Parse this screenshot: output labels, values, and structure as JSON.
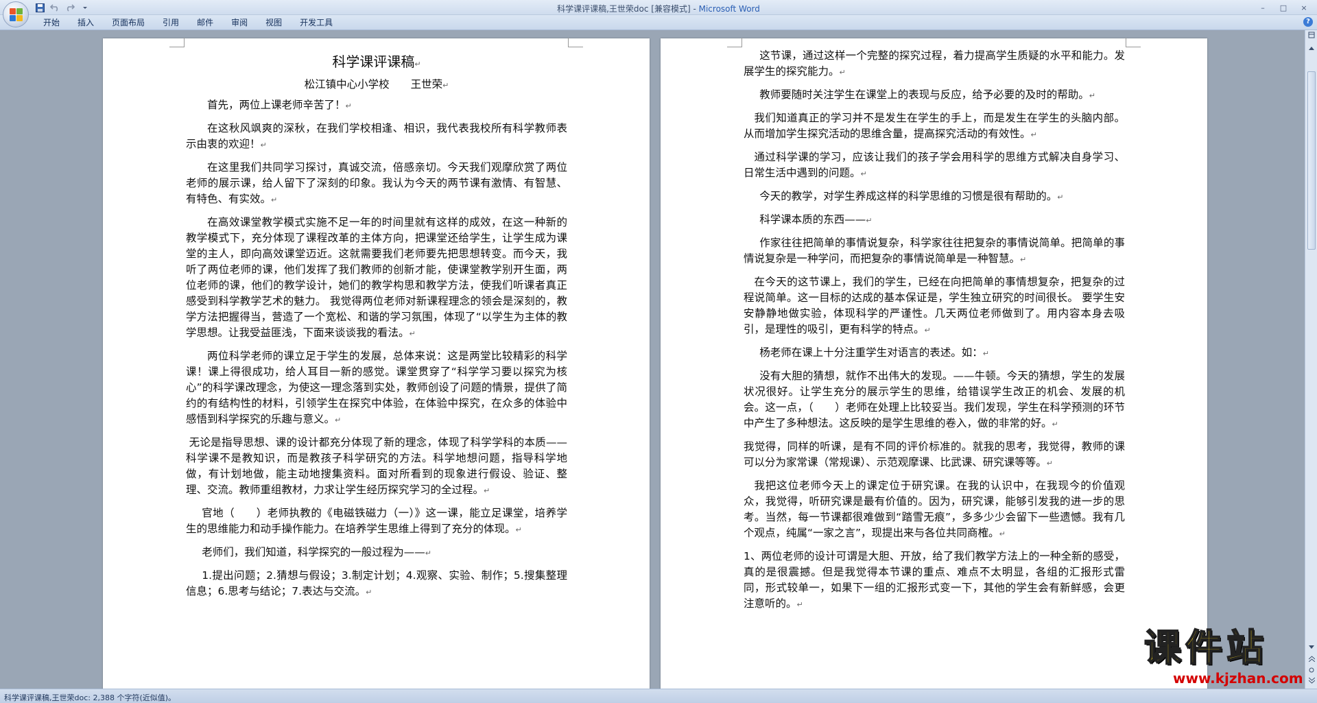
{
  "window": {
    "title": "科学课评课稿,王世荣doc [兼容模式] - ",
    "app": "Microsoft Word",
    "controls": [
      "–",
      "□",
      "×"
    ]
  },
  "quick_access": {
    "icons": [
      "save-icon",
      "undo-icon",
      "redo-icon",
      "customize-icon"
    ]
  },
  "ribbon": {
    "tabs": [
      "开始",
      "插入",
      "页面布局",
      "引用",
      "邮件",
      "审阅",
      "视图",
      "开发工具"
    ],
    "help": "?"
  },
  "doc": {
    "left": {
      "title": "科学课评课稿",
      "subtitle": "松江镇中心小学校　　王世荣",
      "paragraphs": [
        "首先，两位上课老师辛苦了！",
        "在这秋风飒爽的深秋，在我们学校相逢、相识，我代表我校所有科学教师表示由衷的欢迎！",
        "在这里我们共同学习探讨，真诚交流，倍感亲切。今天我们观摩欣赏了两位老师的展示课，给人留下了深刻的印象。我认为今天的两节课有激情、有智慧、有特色、有实效。",
        "在高效课堂教学模式实施不足一年的时间里就有这样的成效，在这一种新的教学模式下，充分体现了课程改革的主体方向，把课堂还给学生，让学生成为课堂的主人，即向高效课堂迈近。这就需要我们老师要先把思想转变。而今天，我听了两位老师的课，他们发挥了我们教师的创新才能，使课堂教学别开生面，两位老师的课，他们的教学设计，她们的教学构思和教学方法，使我们听课者真正感受到科学教学艺术的魅力。 我觉得两位老师对新课程理念的领会是深刻的，教学方法把握得当，营造了一个宽松、和谐的学习氛围，体现了“以学生为主体的教学思想。让我受益匪浅，下面来谈谈我的看法。",
        "两位科学老师的课立足于学生的发展，总体来说：这是两堂比较精彩的科学课！课上得很成功，给人耳目一新的感觉。课堂贯穿了“科学学习要以探究为核心”的科学课改理念，为使这一理念落到实处，教师创设了问题的情景，提供了简约的有结构性的材料，引领学生在探究中体验，在体验中探究，在众多的体验中感悟到科学探究的乐趣与意义。",
        "无论是指导思想、课的设计都充分体现了新的理念，体现了科学学科的本质——科学课不是教知识，而是教孩子科学研究的方法。科学地想问题，指导科学地做，有计划地做，能主动地搜集资料。面对所看到的现象进行假设、验证、整理、交流。教师重组教材，力求让学生经历探究学习的全过程。",
        "官地（　　）老师执教的《电磁铁磁力（一）》这一课，能立足课堂，培养学生的思维能力和动手操作能力。在培养学生思维上得到了充分的体现。",
        "老师们，我们知道，科学探究的一般过程为——",
        "1.提出问题；2.猜想与假设；3.制定计划；4.观察、实验、制作；5.搜集整理信息；6.思考与结论；7.表达与交流。"
      ]
    },
    "right": {
      "paragraphs": [
        "这节课，通过这样一个完整的探究过程，着力提高学生质疑的水平和能力。发展学生的探究能力。",
        "教师要随时关注学生在课堂上的表现与反应，给予必要的及时的帮助。",
        "我们知道真正的学习并不是发生在学生的手上，而是发生在学生的头脑内部。从而增加学生探究活动的思维含量，提高探究活动的有效性。",
        "通过科学课的学习，应该让我们的孩子学会用科学的思维方式解决自身学习、日常生活中遇到的问题。",
        "今天的教学，对学生养成这样的科学思维的习惯是很有帮助的。",
        "科学课本质的东西——",
        "作家往往把简单的事情说复杂，科学家往往把复杂的事情说简单。把简单的事情说复杂是一种学问，而把复杂的事情说简单是一种智慧。",
        "在今天的这节课上，我们的学生，已经在向把简单的事情想复杂，把复杂的过程说简单。这一目标的达成的基本保证是，学生独立研究的时间很长。 要学生安安静静地做实验，体现科学的严谨性。几天两位老师做到了。用内容本身去吸引，是理性的吸引，更有科学的特点。",
        "杨老师在课上十分注重学生对语言的表述。如：",
        "没有大胆的猜想，就作不出伟大的发现。——牛顿。今天的猜想，学生的发展状况很好。让学生充分的展示学生的思维，给错误学生改正的机会、发展的机会。这一点，（　　）老师在处理上比较妥当。我们发现，学生在科学预测的环节中产生了多种想法。这反映的是学生思维的卷入，做的非常的好。",
        "我觉得，同样的听课，是有不同的评价标准的。就我的思考，我觉得，教师的课可以分为家常课（常规课）、示范观摩课、比武课、研究课等等。",
        "我把这位老师今天上的课定位于研究课。在我的认识中，在我现今的价值观众，我觉得，听研究课是最有价值的。因为，研究课，能够引发我的进一步的思考。当然，每一节课都很难做到“踏雪无痕”，多多少少会留下一些遗憾。我有几个观点，纯属“一家之言”，现提出来与各位共同商榷。",
        "1、两位老师的设计可谓是大胆、开放，给了我们教学方法上的一种全新的感受，真的是很震撼。但是我觉得本节课的重点、难点不太明显，各组的汇报形式雷同，形式较单一，如果下一组的汇报形式变一下，其他的学生会有新鲜感，会更注意听的。"
      ]
    },
    "paragraph_mark": "↵"
  },
  "status": {
    "text": "科学课评课稿,王世荣doc: 2,388 个字符(近似值)。"
  },
  "watermark": {
    "main": "课件站",
    "url": "www.kjzhan.com"
  }
}
